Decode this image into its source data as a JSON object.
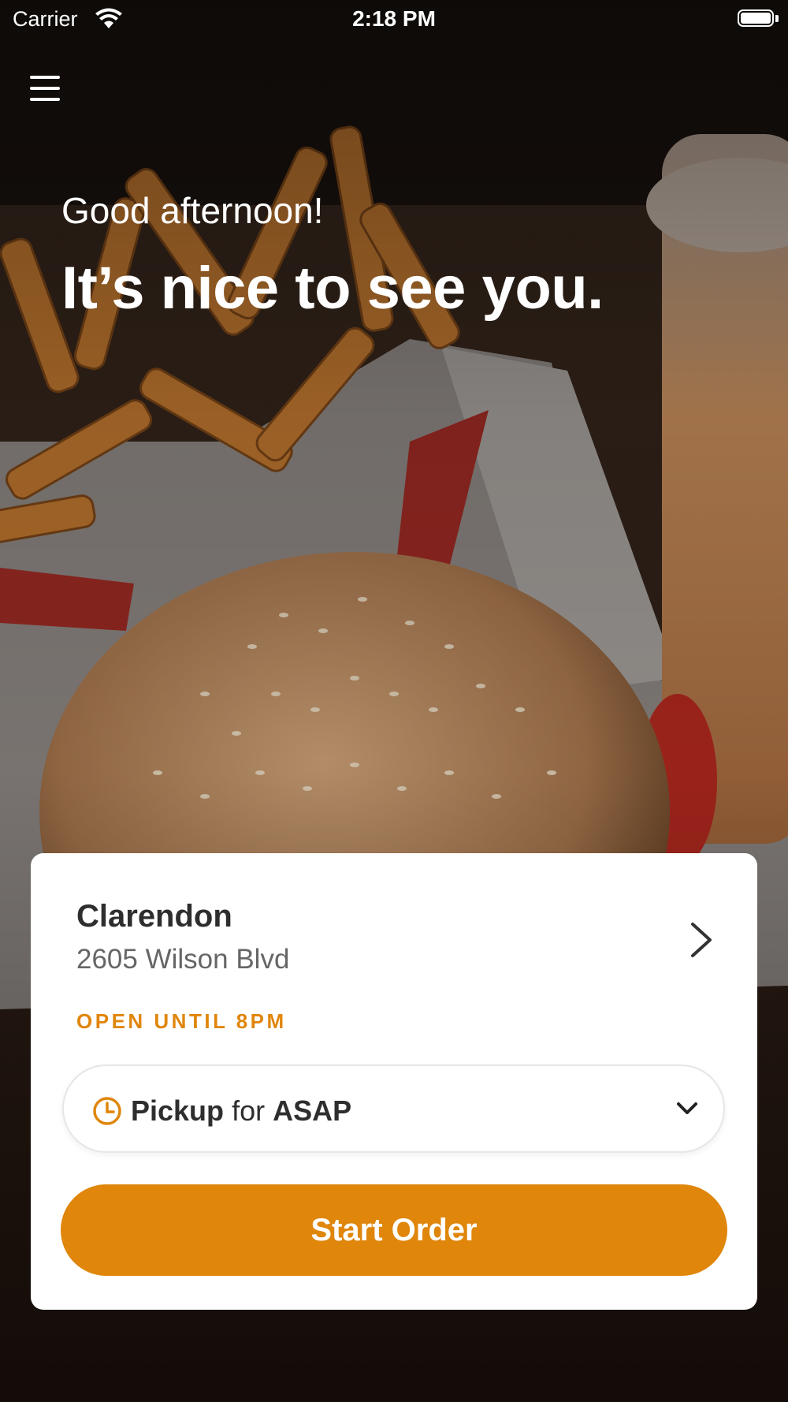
{
  "status_bar": {
    "carrier": "Carrier",
    "time": "2:18 PM"
  },
  "header": {
    "greeting": "Good afternoon!",
    "headline": "It’s nice to see you."
  },
  "location_card": {
    "name": "Clarendon",
    "address": "2605 Wilson Blvd",
    "open_status": "OPEN UNTIL 8PM",
    "pickup": {
      "mode": "Pickup",
      "connector": "for",
      "time": "ASAP"
    },
    "start_button": "Start Order"
  },
  "colors": {
    "accent": "#df860b",
    "open_status": "#e0860c",
    "card_background": "#ffffff"
  },
  "icons": {
    "menu": "hamburger-icon",
    "location_chevron": "chevron-right-icon",
    "pickup_clock": "clock-icon",
    "pickup_dropdown": "chevron-down-icon"
  }
}
